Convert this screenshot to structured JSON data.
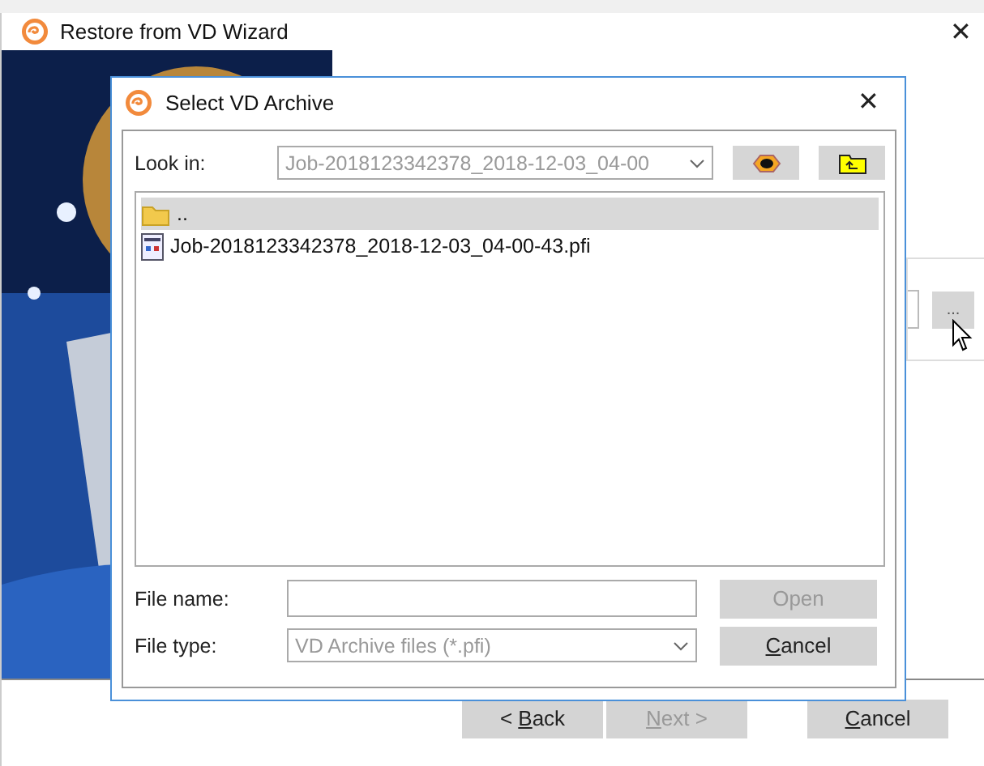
{
  "wizard": {
    "title": "Restore from VD Wizard",
    "close": "✕",
    "browse_button": "...",
    "buttons": [
      {
        "before": "< ",
        "mnemonic": "B",
        "after": "ack",
        "disabled": false
      },
      {
        "mnemonic": "N",
        "after": "ext >",
        "disabled": true
      },
      {
        "mnemonic": "C",
        "after": "ancel",
        "disabled": false
      }
    ]
  },
  "dialog": {
    "title": "Select VD Archive",
    "close": "✕",
    "look_in_label": "Look in:",
    "look_in_value": "Job-2018123342378_2018-12-03_04-00",
    "files": [
      {
        "name": "..",
        "kind": "folder",
        "selected": true
      },
      {
        "name": "Job-2018123342378_2018-12-03_04-00-43.pfi",
        "kind": "file",
        "selected": false
      }
    ],
    "file_name_label": "File name:",
    "file_type_label": "File type:",
    "file_type_value": "VD Archive files (*.pfi)",
    "buttons": [
      {
        "after": "Open",
        "disabled": true
      },
      {
        "mnemonic": "C",
        "after": "ancel",
        "disabled": false
      }
    ]
  }
}
